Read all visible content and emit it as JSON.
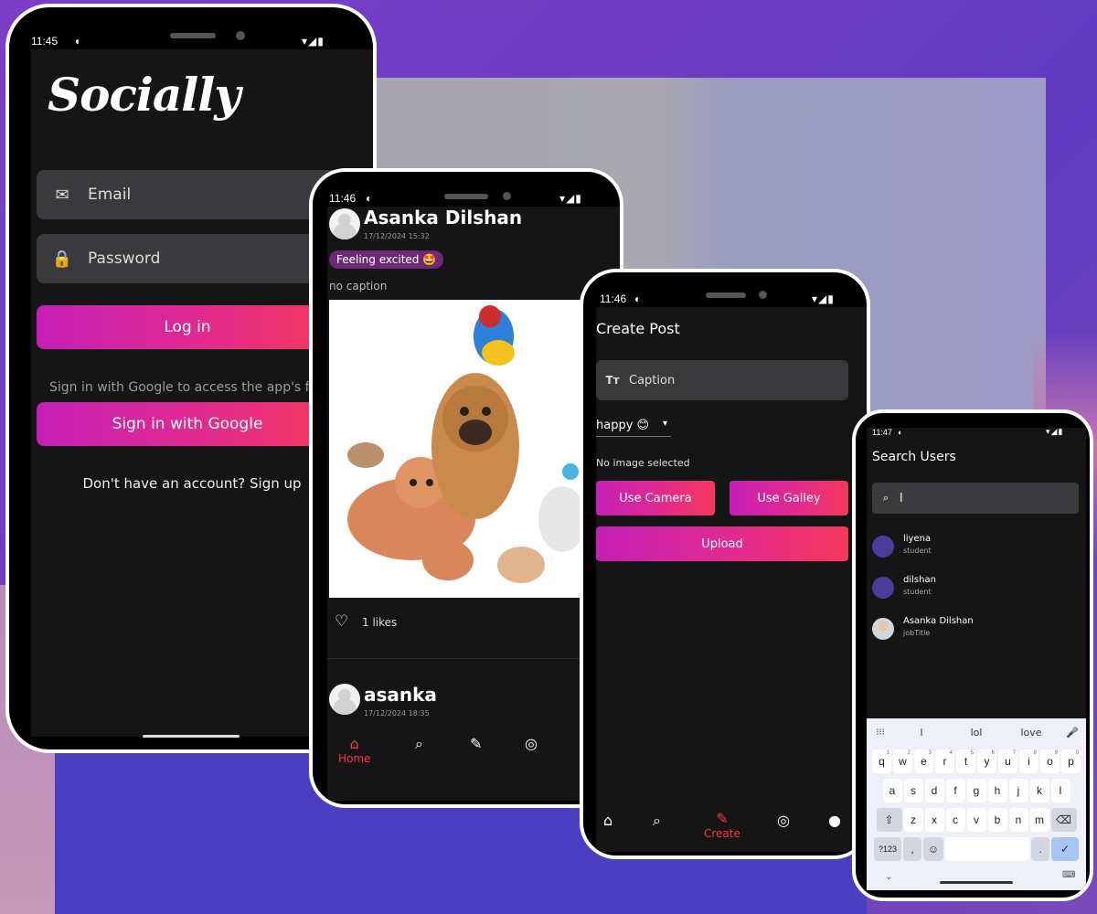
{
  "colors": {
    "accent_start": "#c51fb6",
    "accent_end": "#f5385c",
    "nav_active": "#ff3344",
    "screen_bg": "#151515",
    "field_bg": "#3a3a3c",
    "chip_bg": "#6d2a74"
  },
  "login_screen": {
    "time": "11:45",
    "logo": "Socially",
    "email_placeholder": "Email",
    "password_placeholder": "Password",
    "login_label": "Log in",
    "google_hint": "Sign in with Google to access the app's feat",
    "google_label": "Sign in with Google",
    "signup_text": "Don't have an account? Sign up",
    "icons": {
      "email": "mail-icon",
      "password": "lock-icon"
    }
  },
  "feed_screen": {
    "time": "11:46",
    "post1": {
      "user": "Asanka Dilshan",
      "date": "17/12/2024 15:32",
      "mood_chip": "Feeling excited 🤩",
      "caption": "no caption",
      "likes": "1 likes"
    },
    "post2": {
      "user": "asanka",
      "date": "17/12/2024 18:35"
    },
    "nav": {
      "home": "Home"
    }
  },
  "create_screen": {
    "time": "11:46",
    "title": "Create Post",
    "caption_placeholder": "Caption",
    "mood_value": "happy 😊",
    "no_image": "No image selected",
    "camera_label": "Use Camera",
    "gallery_label": "Use Galley",
    "upload_label": "Upload",
    "nav": {
      "create": "Create"
    }
  },
  "search_screen": {
    "time": "11:47",
    "title": "Search Users",
    "query": "l",
    "users": [
      {
        "name": "liyena",
        "role": "student"
      },
      {
        "name": "dilshan",
        "role": "student"
      },
      {
        "name": "Asanka Dilshan",
        "role": "jobTitle"
      }
    ],
    "suggestions": [
      "l",
      "lol",
      "love"
    ],
    "keys_row1": [
      "q",
      "w",
      "e",
      "r",
      "t",
      "y",
      "u",
      "i",
      "o",
      "p"
    ],
    "keys_row1_hints": [
      "1",
      "2",
      "3",
      "4",
      "5",
      "6",
      "7",
      "8",
      "9",
      "0"
    ],
    "keys_row2": [
      "a",
      "s",
      "d",
      "f",
      "g",
      "h",
      "j",
      "k",
      "l"
    ],
    "keys_row3": [
      "z",
      "x",
      "c",
      "v",
      "b",
      "n",
      "m"
    ],
    "key_sym": "?123",
    "key_comma": ",",
    "key_period": "."
  }
}
